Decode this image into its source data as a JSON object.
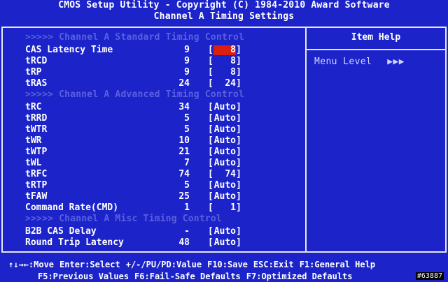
{
  "header": {
    "line1": "CMOS Setup Utility - Copyright (C) 1984-2010 Award Software",
    "line2": "Channel A Timing Settings"
  },
  "help": {
    "title": "Item Help",
    "menu_level_label": "Menu Level",
    "menu_level_arrows": "▶▶▶"
  },
  "sections": {
    "standard": ">>>>>  Channel A Standard Timing Control",
    "advanced": ">>>>>  Channel A Advanced Timing Control",
    "misc": ">>>>>  Channel A Misc Timing Control"
  },
  "items": [
    {
      "name": "CAS Latency Time",
      "current": "9",
      "setting": "8"
    },
    {
      "name": "tRCD",
      "current": "9",
      "setting": "8"
    },
    {
      "name": "tRP",
      "current": "9",
      "setting": "8"
    },
    {
      "name": "tRAS",
      "current": "24",
      "setting": "24"
    },
    {
      "name": "tRC",
      "current": "34",
      "setting": "Auto"
    },
    {
      "name": "tRRD",
      "current": "5",
      "setting": "Auto"
    },
    {
      "name": "tWTR",
      "current": "5",
      "setting": "Auto"
    },
    {
      "name": "tWR",
      "current": "10",
      "setting": "Auto"
    },
    {
      "name": "tWTP",
      "current": "21",
      "setting": "Auto"
    },
    {
      "name": "tWL",
      "current": "7",
      "setting": "Auto"
    },
    {
      "name": "tRFC",
      "current": "74",
      "setting": "74"
    },
    {
      "name": "tRTP",
      "current": "5",
      "setting": "Auto"
    },
    {
      "name": "tFAW",
      "current": "25",
      "setting": "Auto"
    },
    {
      "name": "Command Rate(CMD)",
      "current": "1",
      "setting": "1"
    },
    {
      "name": "B2B CAS Delay",
      "current": "-",
      "setting": "Auto"
    },
    {
      "name": "Round Trip Latency",
      "current": "48",
      "setting": "Auto"
    }
  ],
  "footer": {
    "line1": [
      "↑↓→←:Move",
      "Enter:Select",
      "+/-/PU/PD:Value",
      "F10:Save",
      "ESC:Exit",
      "F1:General Help"
    ],
    "line2": [
      "F5:Previous Values",
      "F6:Fail-Safe Defaults",
      "F7:Optimized Defaults"
    ]
  },
  "watermark": "#63887",
  "colors": {
    "background": "#1c24c9",
    "selection": "#d81f12",
    "section_text": "#5a5fe0"
  }
}
